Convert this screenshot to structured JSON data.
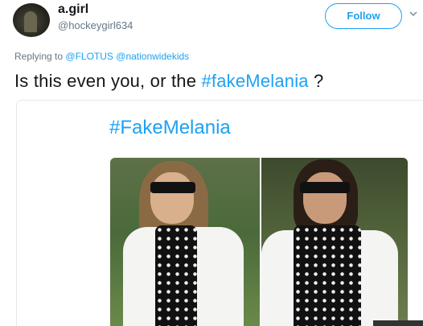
{
  "tweet": {
    "author_name": "a.girl",
    "author_handle": "@hockeygirl634",
    "follow_label": "Follow",
    "reply_prefix": "Replying to",
    "reply_mentions": [
      "@FLOTUS",
      "@nationwidekids"
    ],
    "text_before": "Is this even you, or the ",
    "hashtag": "#fakeMelania",
    "text_after": " ?"
  },
  "card": {
    "title": "#FakeMelania"
  },
  "colors": {
    "accent": "#1da1f2",
    "text": "#14171a",
    "muted": "#657786",
    "border": "#e1e8ed"
  },
  "icons": {
    "more": "chevron-down-icon"
  }
}
